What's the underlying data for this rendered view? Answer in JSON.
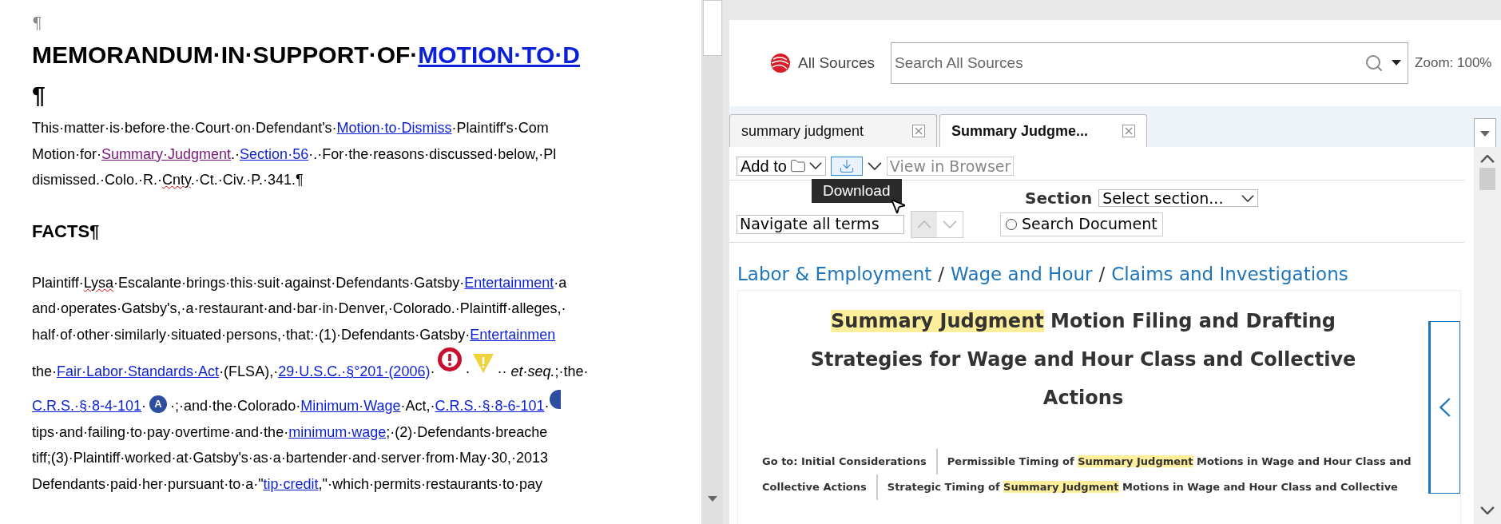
{
  "document": {
    "lines": [
      {
        "kind": "mark",
        "segments": [
          {
            "kind": "text",
            "text": "¶"
          }
        ]
      },
      {
        "kind": "title",
        "segments": [
          {
            "kind": "text",
            "text": "MEMORANDUM·IN·SUPPORT·OF·"
          },
          {
            "kind": "link",
            "text": "MOTION·TO·D"
          }
        ]
      },
      {
        "kind": "title",
        "segments": [
          {
            "kind": "text",
            "text": "¶"
          }
        ]
      },
      {
        "kind": "body",
        "segments": [
          {
            "kind": "text",
            "text": "This·matter·is·before·the·Court·on·Defendant's·"
          },
          {
            "kind": "link",
            "text": "Motion·to·Dismiss"
          },
          {
            "kind": "text",
            "text": "·Plaintiff's·Com"
          }
        ]
      },
      {
        "kind": "body",
        "segments": [
          {
            "kind": "text",
            "text": "Motion·for·"
          },
          {
            "kind": "visited",
            "text": "Summary·Judgment"
          },
          {
            "kind": "text",
            "text": ".·"
          },
          {
            "kind": "link",
            "text": "Section·56"
          },
          {
            "kind": "text",
            "text": "·.·For·the·reasons·discussed·below,·Pl"
          }
        ]
      },
      {
        "kind": "body",
        "segments": [
          {
            "kind": "text",
            "text": "dismissed.·Colo.·R.·"
          },
          {
            "kind": "misspelled",
            "text": "Cnty"
          },
          {
            "kind": "text",
            "text": ".·Ct.·Civ.·P.·341.¶"
          }
        ]
      },
      {
        "kind": "blank"
      },
      {
        "kind": "heading",
        "segments": [
          {
            "kind": "text",
            "text": "FACTS¶"
          }
        ]
      },
      {
        "kind": "blank"
      },
      {
        "kind": "body",
        "segments": [
          {
            "kind": "text",
            "text": "Plaintiff·"
          },
          {
            "kind": "misspelled",
            "text": "Lysa"
          },
          {
            "kind": "text",
            "text": "·Escalante·brings·this·suit·against·Defendants·Gatsby·"
          },
          {
            "kind": "link",
            "text": "Entertainment"
          },
          {
            "kind": "text",
            "text": "·a"
          }
        ]
      },
      {
        "kind": "body",
        "segments": [
          {
            "kind": "text",
            "text": "and·operates·Gatsby's,·a·restaurant·and·bar·in·Denver,·Colorado.·Plaintiff·alleges,·"
          }
        ]
      },
      {
        "kind": "body",
        "segments": [
          {
            "kind": "text",
            "text": "half·of·other·similarly·situated·persons,·that:·(1)·Defendants·Gatsby·"
          },
          {
            "kind": "link",
            "text": "Entertainmen"
          }
        ]
      },
      {
        "kind": "tall",
        "segments": [
          {
            "kind": "text",
            "text": "the·"
          },
          {
            "kind": "link",
            "text": "Fair·Labor·Standards·Act"
          },
          {
            "kind": "text",
            "text": "·(FLSA),·"
          },
          {
            "kind": "link",
            "text": "29·U.S.C.·§°201·(2006)"
          },
          {
            "kind": "text",
            "text": "·"
          },
          {
            "kind": "alert"
          },
          {
            "kind": "text",
            "text": "·"
          },
          {
            "kind": "warning"
          },
          {
            "kind": "text",
            "text": "·· "
          },
          {
            "kind": "italic",
            "text": "et·seq."
          },
          {
            "kind": "text",
            "text": ";·the·"
          }
        ]
      },
      {
        "kind": "body",
        "segments": [
          {
            "kind": "link",
            "text": "C.R.S.·§·8-4-101"
          },
          {
            "kind": "text",
            "text": "·"
          },
          {
            "kind": "badge",
            "text": "A"
          },
          {
            "kind": "text",
            "text": "·;·and·the·Colorado·"
          },
          {
            "kind": "link",
            "text": "Minimum·Wage"
          },
          {
            "kind": "text",
            "text": "·Act,·"
          },
          {
            "kind": "link",
            "text": "C.R.S.·§·8-6-101"
          },
          {
            "kind": "text",
            "text": "·"
          },
          {
            "kind": "marker"
          }
        ]
      },
      {
        "kind": "body",
        "segments": [
          {
            "kind": "text",
            "text": "tips·and·failing·to·pay·overtime·and·the·"
          },
          {
            "kind": "link",
            "text": "minimum·wage"
          },
          {
            "kind": "text",
            "text": ";·(2)·Defendants·breache"
          }
        ]
      },
      {
        "kind": "body",
        "segments": [
          {
            "kind": "text",
            "text": "tiff;(3)·Plaintiff·worked·at·Gatsby's·as·a·bartender·and·server·from·May·30,·2013"
          }
        ]
      },
      {
        "kind": "body",
        "segments": [
          {
            "kind": "text",
            "text": "Defendants·paid·her·pursuant·to·a·\""
          },
          {
            "kind": "link",
            "text": "tip·credit"
          },
          {
            "kind": "text",
            "text": ",\"·which·permits·restaurants·to·pay"
          }
        ]
      }
    ]
  },
  "lexis": {
    "scope": "All Sources",
    "search": {
      "placeholder": "Search All Sources"
    },
    "zoom": "Zoom: 100%",
    "tabs": [
      {
        "label": "summary judgment",
        "selected": false
      },
      {
        "label": "Summary Judgme...",
        "selected": true
      }
    ],
    "toolbar": {
      "add_to": "Add to",
      "view_in_browser": "View in Browser",
      "tooltip": "Download"
    },
    "section": {
      "label": "Section",
      "value": "Select section..."
    },
    "navigate": {
      "value": "Navigate all terms"
    },
    "search_document": {
      "label": "Search Document",
      "selected": false
    },
    "breadcrumb": [
      {
        "kind": "link",
        "text": "Labor & Employment"
      },
      {
        "kind": "separator",
        "text": "/"
      },
      {
        "kind": "link",
        "text": "Wage and Hour"
      },
      {
        "kind": "separator",
        "text": "/"
      },
      {
        "kind": "link",
        "text": "Claims and Investigations"
      }
    ],
    "article": {
      "title": [
        {
          "text": "Summary Judgment",
          "highlight": true
        },
        {
          "text": " Motion Filing and Drafting Strategies for Wage and Hour Class and Collective Actions",
          "highlight": false
        }
      ],
      "goto_rows": [
        [
          [
            {
              "text": "Go to: Initial Considerations",
              "highlight": false
            }
          ],
          [
            {
              "text": "Permissible Timing of ",
              "highlight": false
            },
            {
              "text": "Summary Judgment",
              "highlight": true
            },
            {
              "text": " Motions in Wage and Hour Class and",
              "highlight": false
            }
          ]
        ],
        [
          [
            {
              "text": "Collective Actions",
              "highlight": false
            }
          ],
          [
            {
              "text": "Strategic Timing of ",
              "highlight": false
            },
            {
              "text": "Summary Judgment",
              "highlight": true
            },
            {
              "text": " Motions in Wage and Hour Class and Collective",
              "highlight": false
            }
          ]
        ]
      ]
    }
  }
}
